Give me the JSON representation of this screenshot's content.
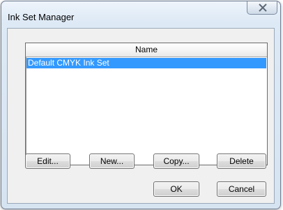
{
  "window": {
    "title": "Ink Set Manager",
    "close_icon": "close-icon"
  },
  "list": {
    "column_header": "Name",
    "items": [
      {
        "label": "Default CMYK Ink Set",
        "selected": true
      }
    ]
  },
  "buttons": {
    "edit": "Edit...",
    "new": "New...",
    "copy": "Copy...",
    "delete": "Delete",
    "ok": "OK",
    "cancel": "Cancel"
  },
  "colors": {
    "selection": "#3399ff",
    "dialog_face": "#f0f0f0"
  }
}
